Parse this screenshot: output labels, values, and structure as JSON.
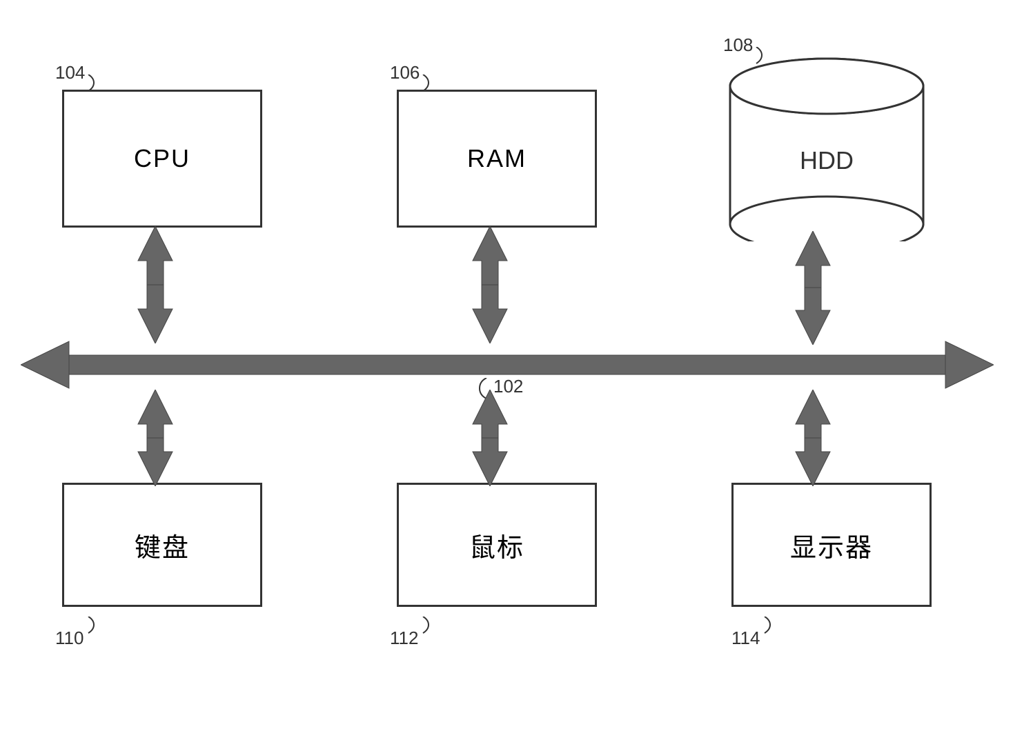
{
  "components": {
    "cpu": {
      "label": "CPU",
      "ref": "104"
    },
    "ram": {
      "label": "RAM",
      "ref": "106"
    },
    "hdd": {
      "label": "HDD",
      "ref": "108"
    },
    "bus": {
      "ref": "102"
    },
    "keyboard": {
      "label": "键盘",
      "ref": "110"
    },
    "mouse": {
      "label": "鼠标",
      "ref": "112"
    },
    "monitor": {
      "label": "显示器",
      "ref": "114"
    }
  }
}
